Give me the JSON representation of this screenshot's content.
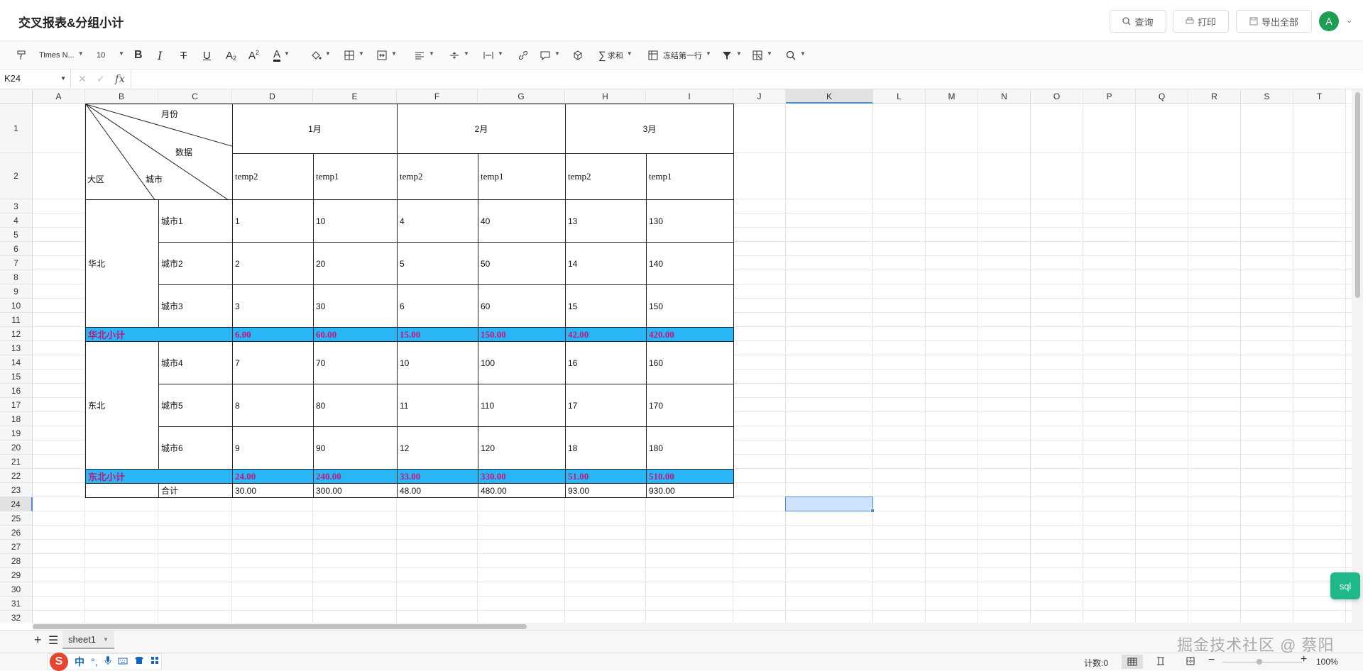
{
  "app": {
    "title": "交叉报表&分组小计"
  },
  "header_buttons": {
    "query": "查询",
    "print": "打印",
    "export": "导出全部"
  },
  "user": {
    "avatar_letter": "A"
  },
  "toolbar": {
    "font_name": "Times N...",
    "font_size": "10",
    "sum": "求和",
    "freeze": "冻结第一行"
  },
  "formula_bar": {
    "cell_ref": "K24",
    "fx": "fx",
    "value": ""
  },
  "columns": [
    "A",
    "B",
    "C",
    "D",
    "E",
    "F",
    "G",
    "H",
    "I",
    "J",
    "K",
    "L",
    "M",
    "N",
    "O",
    "P",
    "Q",
    "R",
    "S",
    "T"
  ],
  "rows": [
    "1",
    "2",
    "3",
    "4",
    "5",
    "6",
    "7",
    "8",
    "9",
    "10",
    "11",
    "12",
    "13",
    "14",
    "15",
    "16",
    "17",
    "18",
    "19",
    "20",
    "21",
    "22",
    "23",
    "24",
    "25",
    "26",
    "27",
    "28",
    "29",
    "30",
    "31",
    "32"
  ],
  "selected": {
    "column": "K",
    "row": "24"
  },
  "report": {
    "header": {
      "month_label": "月份",
      "data_label": "数据",
      "region_label": "大区",
      "city_label": "城市"
    },
    "months": [
      "1月",
      "2月",
      "3月"
    ],
    "subheaders": [
      "temp2",
      "temp1",
      "temp2",
      "temp1",
      "temp2",
      "temp1"
    ],
    "groups": [
      {
        "region": "华北",
        "cities": [
          {
            "name": "城市1",
            "values": [
              "1",
              "10",
              "4",
              "40",
              "13",
              "130"
            ]
          },
          {
            "name": "城市2",
            "values": [
              "2",
              "20",
              "5",
              "50",
              "14",
              "140"
            ]
          },
          {
            "name": "城市3",
            "values": [
              "3",
              "30",
              "6",
              "60",
              "15",
              "150"
            ]
          }
        ],
        "subtotal_label": "华北小计",
        "subtotal": [
          "6.00",
          "60.00",
          "15.00",
          "150.00",
          "42.00",
          "420.00"
        ]
      },
      {
        "region": "东北",
        "cities": [
          {
            "name": "城市4",
            "values": [
              "7",
              "70",
              "10",
              "100",
              "16",
              "160"
            ]
          },
          {
            "name": "城市5",
            "values": [
              "8",
              "80",
              "11",
              "110",
              "17",
              "170"
            ]
          },
          {
            "name": "城市6",
            "values": [
              "9",
              "90",
              "12",
              "120",
              "18",
              "180"
            ]
          }
        ],
        "subtotal_label": "东北小计",
        "subtotal": [
          "24.00",
          "240.00",
          "33.00",
          "330.00",
          "51.00",
          "510.00"
        ]
      }
    ],
    "total_label": "合计",
    "total": [
      "30.00",
      "300.00",
      "48.00",
      "480.00",
      "93.00",
      "930.00"
    ]
  },
  "sheet": {
    "tab": "sheet1"
  },
  "status": {
    "count": "计数:0",
    "zoom": "100%"
  },
  "ime": {
    "lang": "中"
  },
  "watermark": "掘金技术社区 @ 蔡阳",
  "sql_button": "sql",
  "colors": {
    "subtotal_bg": "#29b6f6",
    "subtotal_text": "#c2187e",
    "avatar": "#1f9d55",
    "sql": "#1fb88a"
  }
}
